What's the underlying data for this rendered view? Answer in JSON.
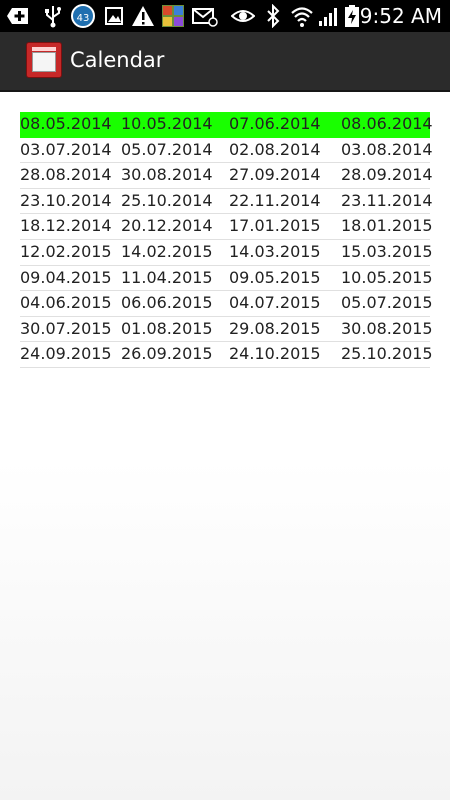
{
  "status_bar": {
    "time": "9:52 AM",
    "notification_count": "43",
    "icons": [
      "add-icon",
      "usb-icon",
      "notification-count-icon",
      "image-icon",
      "warning-icon",
      "game-icon",
      "email-icon",
      "eye-icon",
      "bluetooth-icon",
      "wifi-icon",
      "signal-icon",
      "battery-charging-icon"
    ]
  },
  "action_bar": {
    "title": "Calendar",
    "icon": "calendar-app-icon"
  },
  "colors": {
    "highlight": "#19ff00",
    "action_bar": "#2b2b2b",
    "status_bar": "#000000"
  },
  "table": {
    "highlighted_row": 0,
    "rows": [
      [
        "08.05.2014",
        "10.05.2014",
        "07.06.2014",
        "08.06.2014"
      ],
      [
        "03.07.2014",
        "05.07.2014",
        "02.08.2014",
        "03.08.2014"
      ],
      [
        "28.08.2014",
        "30.08.2014",
        "27.09.2014",
        "28.09.2014"
      ],
      [
        "23.10.2014",
        "25.10.2014",
        "22.11.2014",
        "23.11.2014"
      ],
      [
        "18.12.2014",
        "20.12.2014",
        "17.01.2015",
        "18.01.2015"
      ],
      [
        "12.02.2015",
        "14.02.2015",
        "14.03.2015",
        "15.03.2015"
      ],
      [
        "09.04.2015",
        "11.04.2015",
        "09.05.2015",
        "10.05.2015"
      ],
      [
        "04.06.2015",
        "06.06.2015",
        "04.07.2015",
        "05.07.2015"
      ],
      [
        "30.07.2015",
        "01.08.2015",
        "29.08.2015",
        "30.08.2015"
      ],
      [
        "24.09.2015",
        "26.09.2015",
        "24.10.2015",
        "25.10.2015"
      ]
    ]
  }
}
